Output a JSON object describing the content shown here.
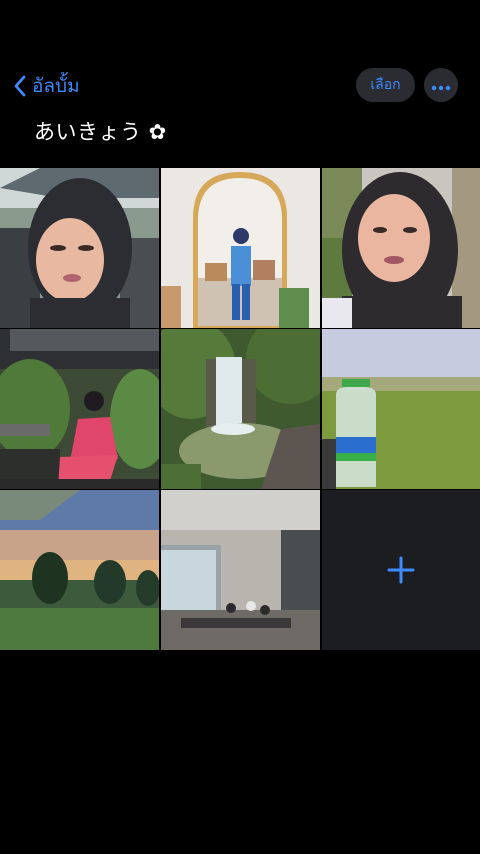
{
  "nav": {
    "back_label": "อัลบั้ม",
    "select_label": "เลือก"
  },
  "album": {
    "title": "あいきょう ✿"
  },
  "photos": [
    {
      "name": "photo-selfie-1"
    },
    {
      "name": "photo-mirror-selfie"
    },
    {
      "name": "photo-selfie-2"
    },
    {
      "name": "photo-garden-seated"
    },
    {
      "name": "photo-waterfall"
    },
    {
      "name": "photo-water-bottle-field"
    },
    {
      "name": "photo-sunset-hills"
    },
    {
      "name": "photo-cafe-interior"
    }
  ],
  "icons": {
    "back": "chevron-left-icon",
    "more": "ellipsis-icon",
    "add": "plus-icon"
  },
  "colors": {
    "accent": "#3d8bff",
    "button_bg": "#2a2c31",
    "background": "#000000",
    "add_tile": "#1c1d21"
  }
}
